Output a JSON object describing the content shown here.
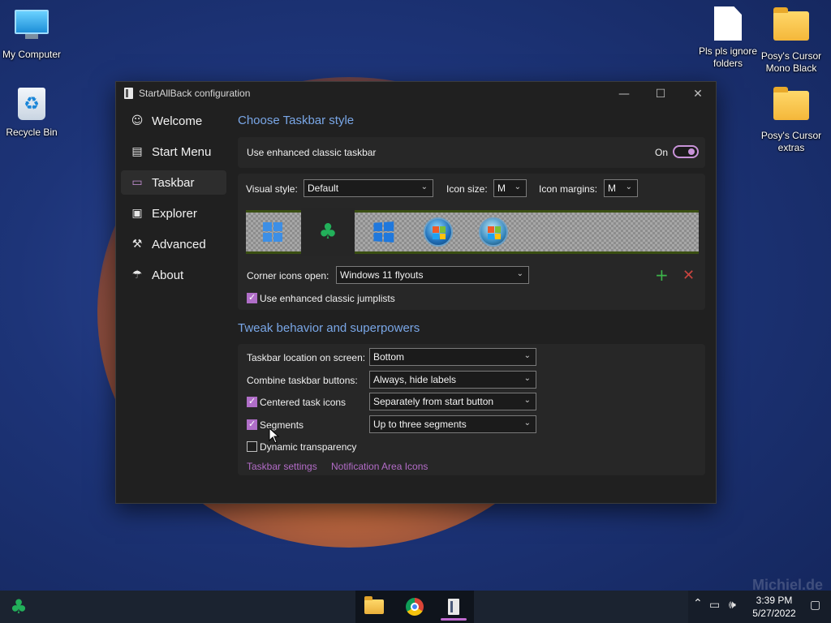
{
  "desktop": {
    "icons": [
      {
        "label": "My Computer",
        "icon": "computer-icon"
      },
      {
        "label": "Recycle Bin",
        "icon": "recycle-bin-icon"
      },
      {
        "label": "Pls pls ignore folders",
        "icon": "document-icon"
      },
      {
        "label": "Posy's Cursor Mono Black",
        "icon": "folder-icon"
      },
      {
        "label": "Posy's Cursor extras",
        "icon": "folder-icon"
      }
    ],
    "watermark": "Michiel.de"
  },
  "window": {
    "title": "StartAllBack configuration",
    "controls": {
      "minimize": "—",
      "maximize": "☐",
      "close": "✕"
    }
  },
  "sidebar": {
    "items": [
      {
        "label": "Welcome",
        "icon": "smiley-icon",
        "glyph": "☺"
      },
      {
        "label": "Start Menu",
        "icon": "start-menu-icon",
        "glyph": "▤"
      },
      {
        "label": "Taskbar",
        "icon": "taskbar-icon",
        "glyph": "▭"
      },
      {
        "label": "Explorer",
        "icon": "folder-icon",
        "glyph": "▣"
      },
      {
        "label": "Advanced",
        "icon": "wrench-icon",
        "glyph": "⚒"
      },
      {
        "label": "About",
        "icon": "info-icon",
        "glyph": "☂"
      }
    ],
    "active_index": 2
  },
  "taskbar_style": {
    "heading": "Choose Taskbar style",
    "enhanced_label": "Use enhanced classic taskbar",
    "enhanced_state": "On",
    "visual_style_label": "Visual style:",
    "visual_style_value": "Default",
    "icon_size_label": "Icon size:",
    "icon_size_value": "M",
    "icon_margins_label": "Icon margins:",
    "icon_margins_value": "M",
    "styles": [
      "Windows 11",
      "StartAllBack",
      "Windows 10",
      "Windows 7",
      "Windows Vista"
    ],
    "selected_style_index": 1,
    "corner_icons_label": "Corner icons open:",
    "corner_icons_value": "Windows 11 flyouts",
    "jumplists_label": "Use enhanced classic jumplists",
    "jumplists_checked": true
  },
  "tweak": {
    "heading": "Tweak behavior and superpowers",
    "rows": [
      {
        "label": "Taskbar location on screen:",
        "value": "Bottom"
      },
      {
        "label": "Combine taskbar buttons:",
        "value": "Always, hide labels"
      },
      {
        "label": "Centered task icons",
        "value": "Separately from start button",
        "checked": true
      },
      {
        "label": "Segments",
        "value": "Up to three segments",
        "checked": true
      }
    ],
    "dynamic_label": "Dynamic transparency",
    "dynamic_checked": false,
    "links": [
      "Taskbar settings",
      "Notification Area Icons"
    ]
  },
  "system_taskbar": {
    "pinned": [
      "file-explorer-icon",
      "chrome-icon",
      "startallback-icon"
    ],
    "active_index": 2,
    "clock_time": "3:39 PM",
    "clock_date": "5/27/2022"
  },
  "colors": {
    "accent": "#b36cc8",
    "heading": "#79a6e6",
    "add": "#3cb44a",
    "remove": "#c8443f"
  }
}
